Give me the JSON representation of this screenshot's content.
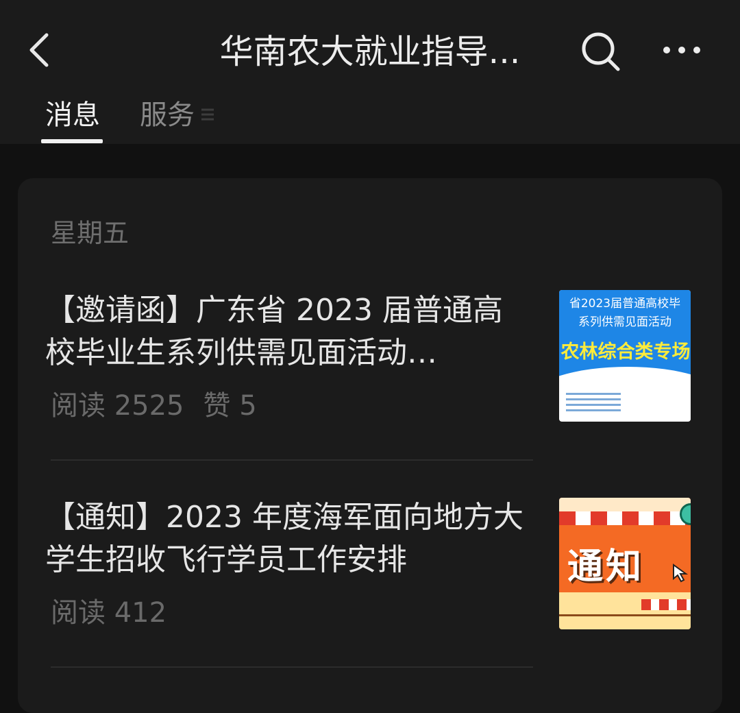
{
  "header": {
    "back_icon": "chevron-left-icon",
    "title": "华南农大就业指导...",
    "search_icon": "search-icon",
    "more_icon": "more-dots-icon"
  },
  "tabs": [
    {
      "label": "消息",
      "active": true
    },
    {
      "label": "服务",
      "active": false,
      "icon": "menu-lines-icon"
    }
  ],
  "feed": {
    "day_label": "星期五",
    "items": [
      {
        "title": "【邀请函】广东省 2023 届普通高校毕业生系列供需见面活动…",
        "meta_read": "阅读 2525",
        "meta_like": "赞 5",
        "thumbnail": {
          "line1": "省2023届普通高校毕",
          "line2": "系列供需见面活动",
          "line3": "农林综合类专场"
        }
      },
      {
        "title": "【通知】2023 年度海军面向地方大学生招收飞行学员工作安排",
        "meta_read": "阅读 412",
        "thumbnail": {
          "word": "通知"
        }
      }
    ]
  },
  "colors": {
    "background": "#111111",
    "header_bg": "#1b1b1b",
    "card_bg": "#1b1b1b",
    "text_primary": "#e6e6e6",
    "text_muted": "#6a6a6a",
    "thumb1_blue": "#1e86e6",
    "thumb1_yellow": "#ffec3a",
    "thumb2_orange": "#f46a24"
  }
}
